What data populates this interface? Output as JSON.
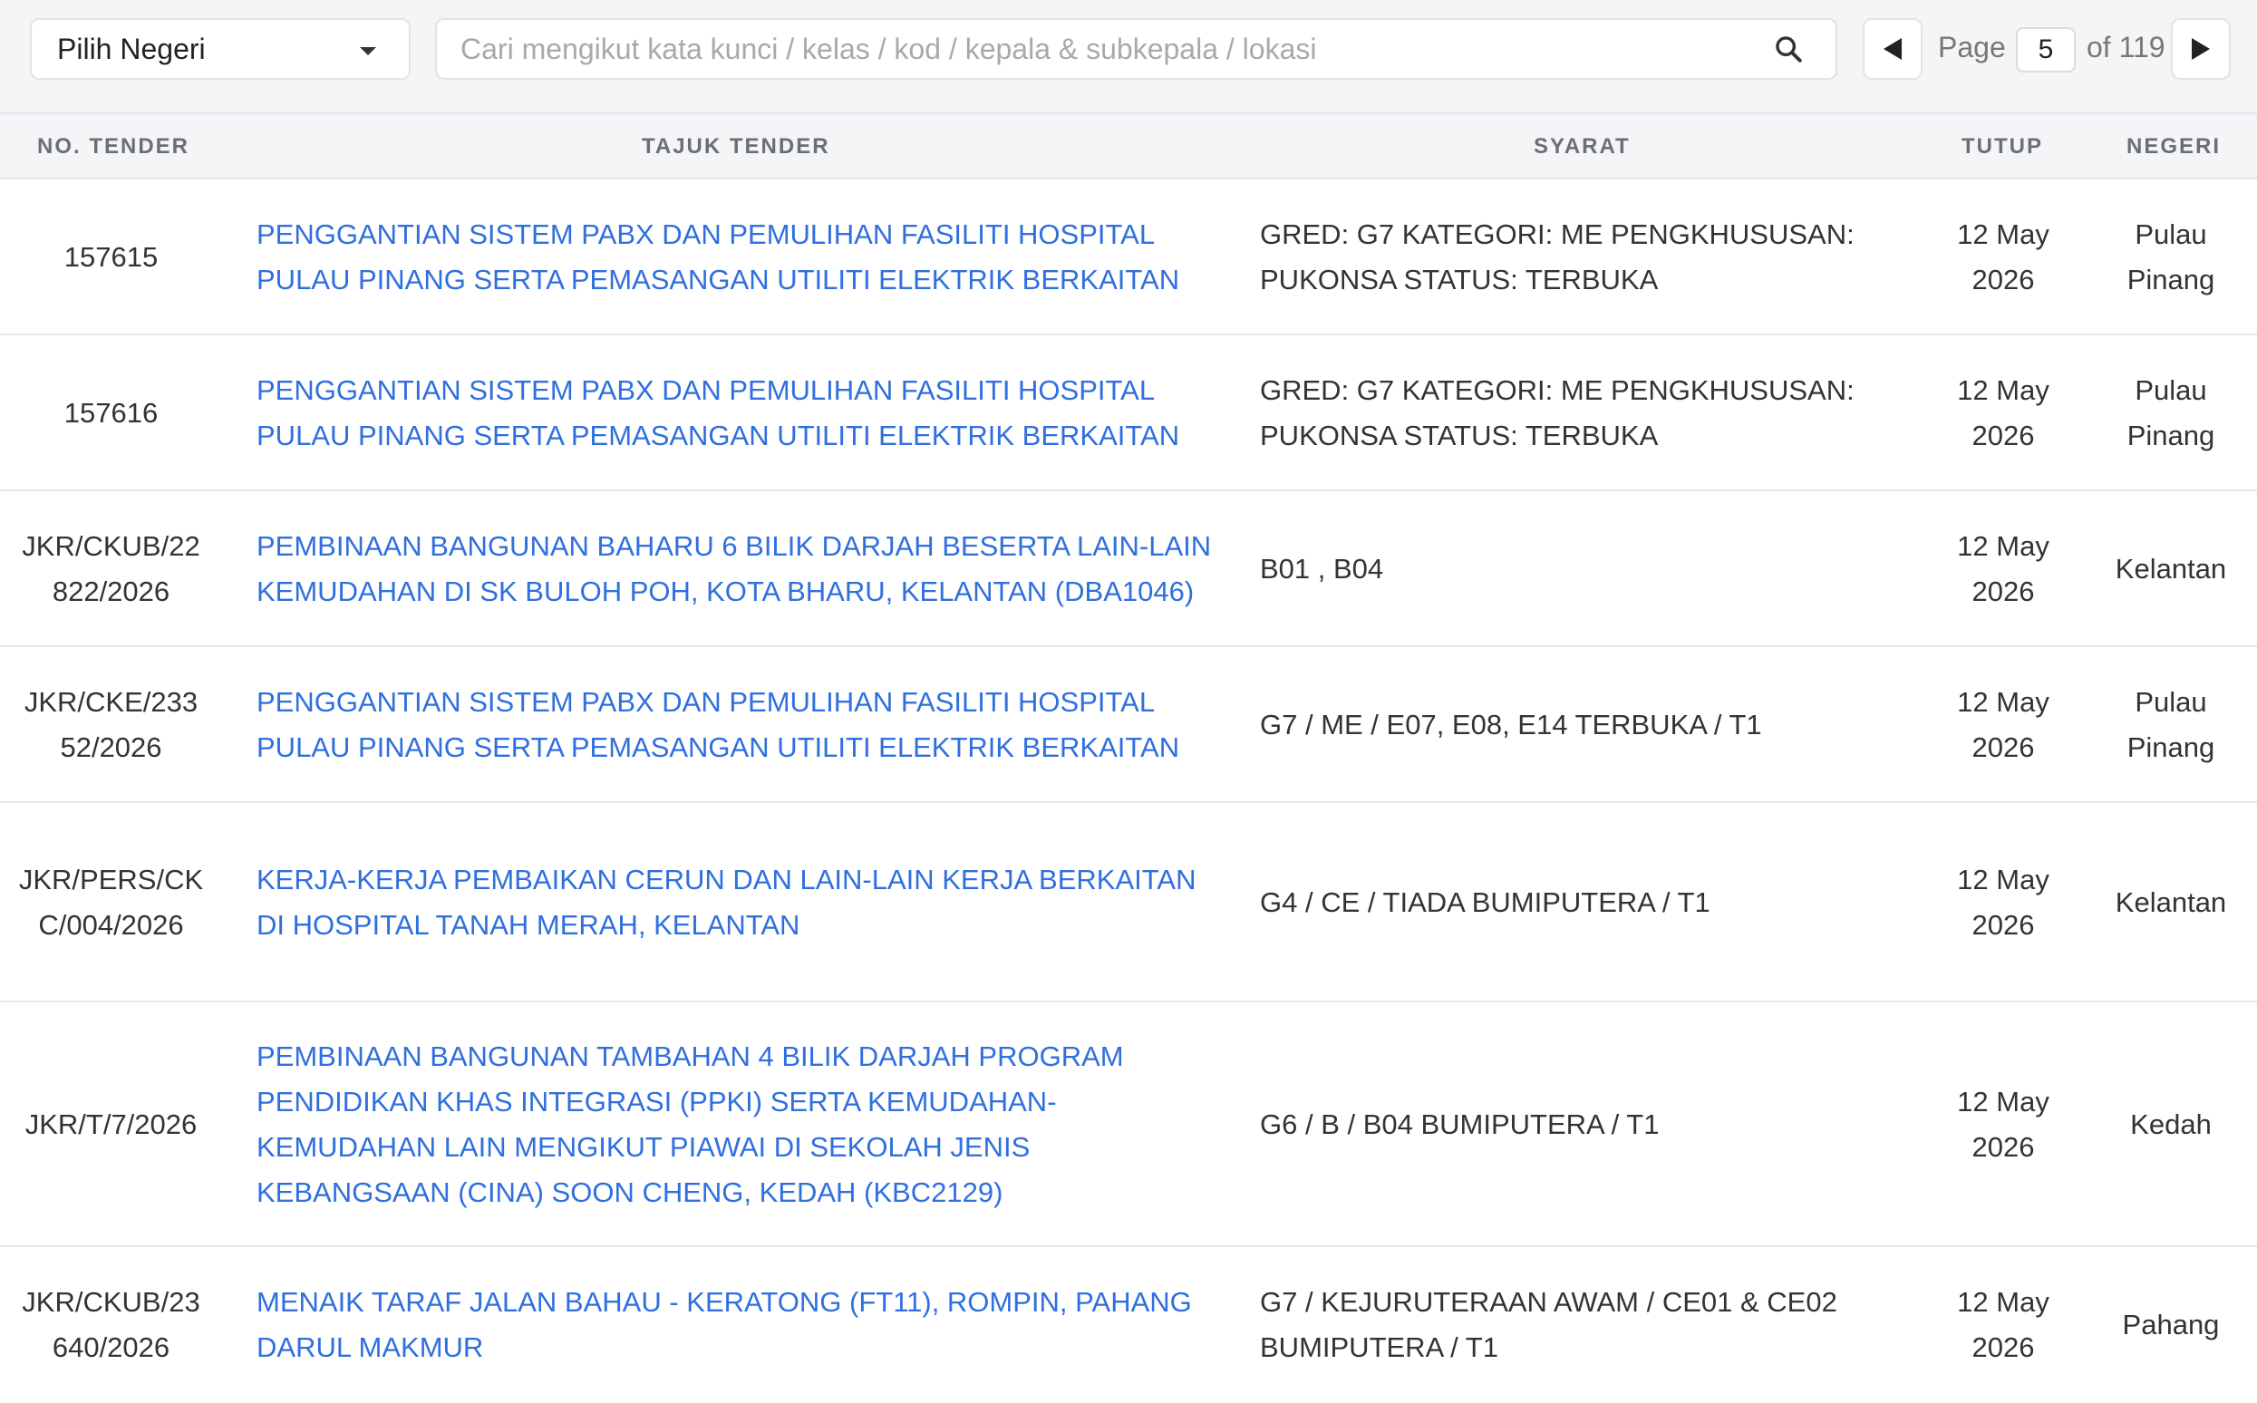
{
  "filter": {
    "state_select_label": "Pilih Negeri",
    "search_placeholder": "Cari mengikut kata kunci / kelas / kod / kepala & subkepala / lokasi"
  },
  "pagination": {
    "page_label": "Page",
    "current_page": "5",
    "of_label": "of 119"
  },
  "table": {
    "headers": {
      "no": "NO. TENDER",
      "title": "TAJUK TENDER",
      "syarat": "SYARAT",
      "tutup": "TUTUP",
      "negeri": "NEGERI"
    },
    "rows": [
      {
        "no": "157615",
        "title": "PENGGANTIAN SISTEM PABX DAN PEMULIHAN FASILITI HOSPITAL PULAU PINANG SERTA PEMASANGAN UTILITI ELEKTRIK BERKAITAN",
        "syarat": "GRED: G7 KATEGORI: ME PENGKHUSUSAN: PUKONSA STATUS: TERBUKA",
        "tutup": "12 May 2026",
        "negeri": "Pulau Pinang"
      },
      {
        "no": "157616",
        "title": "PENGGANTIAN SISTEM PABX DAN PEMULIHAN FASILITI HOSPITAL PULAU PINANG SERTA PEMASANGAN UTILITI ELEKTRIK BERKAITAN",
        "syarat": "GRED: G7 KATEGORI: ME PENGKHUSUSAN: PUKONSA STATUS: TERBUKA",
        "tutup": "12 May 2026",
        "negeri": "Pulau Pinang"
      },
      {
        "no": "JKR/CKUB/22822/2026",
        "title": "PEMBINAAN BANGUNAN BAHARU 6 BILIK DARJAH BESERTA LAIN-LAIN KEMUDAHAN DI SK BULOH POH, KOTA BHARU, KELANTAN (DBA1046)",
        "syarat": "B01 , B04",
        "tutup": "12 May 2026",
        "negeri": "Kelantan"
      },
      {
        "no": "JKR/CKE/23352/2026",
        "title": "PENGGANTIAN SISTEM PABX DAN PEMULIHAN FASILITI HOSPITAL PULAU PINANG SERTA PEMASANGAN UTILITI ELEKTRIK BERKAITAN",
        "syarat": "G7 / ME / E07, E08, E14 TERBUKA / T1",
        "tutup": "12 May 2026",
        "negeri": "Pulau Pinang"
      },
      {
        "no": "JKR/PERS/CKC/004/2026",
        "title": "KERJA-KERJA PEMBAIKAN CERUN DAN LAIN-LAIN KERJA BERKAITAN DI HOSPITAL TANAH MERAH, KELANTAN",
        "syarat": "G4 / CE / TIADA BUMIPUTERA / T1",
        "tutup": "12 May 2026",
        "negeri": "Kelantan"
      },
      {
        "no": "JKR/T/7/2026",
        "title": "PEMBINAAN BANGUNAN TAMBAHAN 4 BILIK DARJAH PROGRAM PENDIDIKAN KHAS INTEGRASI (PPKI) SERTA KEMUDAHAN-KEMUDAHAN LAIN MENGIKUT PIAWAI DI SEKOLAH JENIS KEBANGSAAN (CINA) SOON CHENG, KEDAH (KBC2129)",
        "syarat": "G6 / B / B04 BUMIPUTERA / T1",
        "tutup": "12 May 2026",
        "negeri": "Kedah"
      },
      {
        "no": "JKR/CKUB/23640/2026",
        "title": "MENAIK TARAF JALAN BAHAU - KERATONG (FT11), ROMPIN, PAHANG DARUL MAKMUR",
        "syarat": "G7 / KEJURUTERAAN AWAM / CE01 & CE02 BUMIPUTERA / T1",
        "tutup": "12 May 2026",
        "negeri": "Pahang"
      }
    ]
  }
}
